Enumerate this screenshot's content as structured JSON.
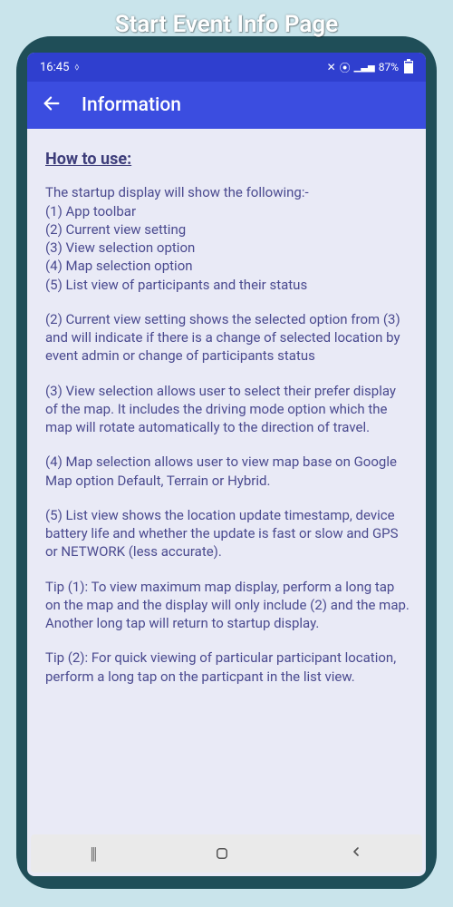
{
  "banner": {
    "title": "Start Event Info Page"
  },
  "status": {
    "time": "16:45",
    "battery_pct": "87%"
  },
  "appbar": {
    "title": "Information"
  },
  "content": {
    "heading": "How to use:",
    "intro": "The startup display will show the following:-",
    "items": {
      "i1": "(1) App toolbar",
      "i2": "(2) Current view setting",
      "i3": "(3) View selection option",
      "i4": "(4) Map selection option",
      "i5": "(5) List view of participants and their status"
    },
    "p2": "(2) Current view setting shows the selected option from (3) and will indicate if there is a change of selected location by event admin or change of participants status",
    "p3": "(3) View selection allows user to select their prefer display of the map. It includes the driving mode option which the map will rotate automatically to the direction of travel.",
    "p4": "(4) Map selection allows user to view map base on Google Map option Default, Terrain or Hybrid.",
    "p5": "(5) List view shows the location update timestamp, device battery life and whether the update is fast or slow and GPS or NETWORK (less accurate).",
    "tip1": "Tip (1): To view maximum map display, perform a long tap on the map and the display will only include (2) and the map. Another long tap will return to startup display.",
    "tip2": "Tip (2): For quick viewing of particular participant location, perform a long tap on the particpant in the list view."
  }
}
